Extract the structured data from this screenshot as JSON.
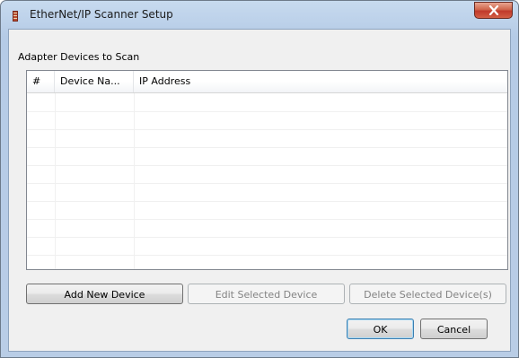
{
  "window": {
    "title": "EtherNet/IP Scanner Setup",
    "close_icon": "close-x-icon",
    "app_icon": "scanner-device-icon"
  },
  "section": {
    "label": "Adapter Devices to Scan"
  },
  "table": {
    "columns": [
      "#",
      "Device Na...",
      "IP Address"
    ],
    "rows": []
  },
  "actions": {
    "add_label": "Add New Device",
    "edit_label": "Edit Selected Device",
    "delete_label": "Delete Selected Device(s)",
    "add_enabled": true,
    "edit_enabled": false,
    "delete_enabled": false
  },
  "footer": {
    "ok_label": "OK",
    "cancel_label": "Cancel"
  },
  "colors": {
    "title_bar": "#b5cbe6",
    "close_button": "#c0392b",
    "dialog_face": "#f0f0f0",
    "default_button_border": "#3c7fb1"
  }
}
